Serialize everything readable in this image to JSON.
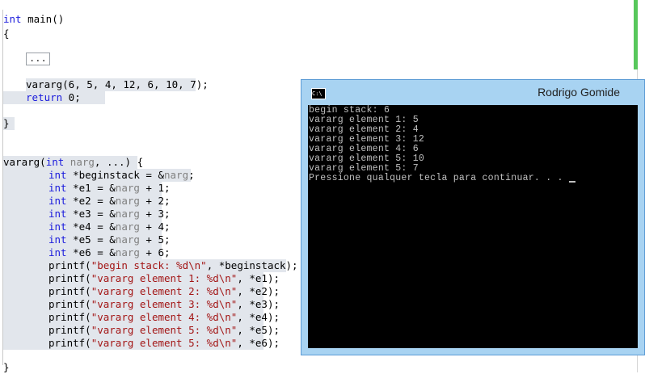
{
  "editor": {
    "main_sig": "main()",
    "kw_int": "int",
    "open_brace": "{",
    "close_brace": "}",
    "collapsed_block": "...",
    "call_line": "vararg(6, 5, 4, 12, 6, 10, 7);",
    "return_kw": "return",
    "return_rest": " 0;",
    "vararg_name": "vararg(",
    "vararg_param": "narg",
    "vararg_rest": ", ...) {",
    "ptr_lines": [
      {
        "decl": " *beginstack = &",
        "tail": ";"
      },
      {
        "decl": " *e1 = &",
        "tail": " + 1;"
      },
      {
        "decl": " *e2 = &",
        "tail": " + 2;"
      },
      {
        "decl": " *e3 = &",
        "tail": " + 3;"
      },
      {
        "decl": " *e4 = &",
        "tail": " + 4;"
      },
      {
        "decl": " *e5 = &",
        "tail": " + 5;"
      },
      {
        "decl": " *e6 = &",
        "tail": " + 6;"
      }
    ],
    "printf_lines": [
      {
        "fn": "printf(",
        "str": "\"begin stack: %d\\n\"",
        "arg": ", *beginstack);"
      },
      {
        "fn": "printf(",
        "str": "\"vararg element 1: %d\\n\"",
        "arg": ", *e1);"
      },
      {
        "fn": "printf(",
        "str": "\"vararg element 2: %d\\n\"",
        "arg": ", *e2);"
      },
      {
        "fn": "printf(",
        "str": "\"vararg element 3: %d\\n\"",
        "arg": ", *e3);"
      },
      {
        "fn": "printf(",
        "str": "\"vararg element 4: %d\\n\"",
        "arg": ", *e4);"
      },
      {
        "fn": "printf(",
        "str": "\"vararg element 5: %d\\n\"",
        "arg": ", *e5);"
      },
      {
        "fn": "printf(",
        "str": "\"vararg element 5: %d\\n\"",
        "arg": ", *e6);"
      }
    ]
  },
  "console": {
    "icon_label": "C:\\",
    "title": "Rodrigo Gomide",
    "lines": [
      "begin stack: 6",
      "vararg element 1: 5",
      "vararg element 2: 4",
      "vararg element 3: 12",
      "vararg element 4: 6",
      "vararg element 5: 10",
      "vararg element 5: 7",
      "Pressione qualquer tecla para continuar. . . "
    ]
  }
}
